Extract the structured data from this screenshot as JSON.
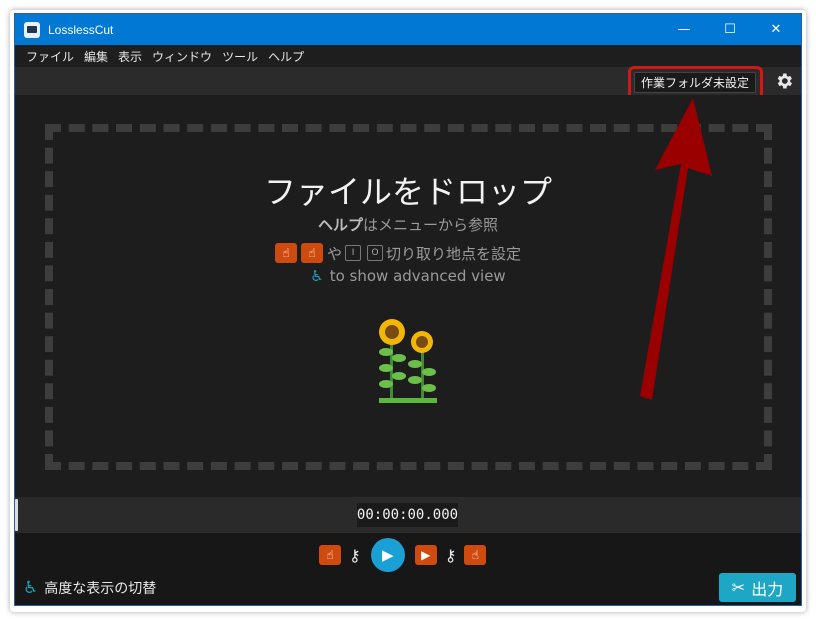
{
  "window": {
    "title": "LosslessCut"
  },
  "window_controls": {
    "minimize": "—",
    "maximize": "☐",
    "close": "✕"
  },
  "menu": [
    "ファイル",
    "編集",
    "表示",
    "ウィンドウ",
    "ツール",
    "ヘルプ"
  ],
  "toolbar": {
    "folder_button": "作業フォルダ未設定",
    "settings_icon": "gear-icon"
  },
  "dropzone": {
    "title": "ファイルをドロップ",
    "help_bold": "ヘルプ",
    "help_rest": "はメニューから参照",
    "cut_conj": "や",
    "key_i": "I",
    "key_o": "O",
    "cut_text": "切り取り地点を設定",
    "advanced_text": "to show advanced view",
    "illustration": "sunflowers"
  },
  "timeline": {
    "timecode": "00:00:00.000"
  },
  "controls": {
    "advanced_toggle": "高度な表示の切替",
    "export_label": "出力",
    "export_icon": "scissors-icon"
  },
  "annotation": {
    "highlight_color": "#d01818",
    "arrow_color": "#9b0000"
  }
}
